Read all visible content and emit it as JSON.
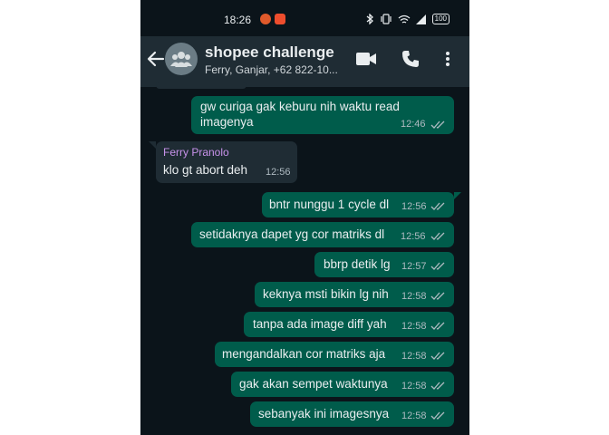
{
  "status_bar": {
    "time": "18:26",
    "battery": "100"
  },
  "header": {
    "title": "shopee challenge",
    "subtitle": "Ferry, Ganjar, +62 822-10..."
  },
  "colors": {
    "background": "#0b141a",
    "header": "#1f2c34",
    "outgoing_bubble": "#005c4b",
    "incoming_bubble": "#1f2c34",
    "sender_name": "#c792ea",
    "ticks": "#aebac1"
  },
  "messages": [
    {
      "direction": "out",
      "text_line1": "gw curiga gak keburu nih waktu read",
      "text_line2": "imagenya",
      "time": "12:46"
    },
    {
      "direction": "in",
      "sender": "Ferry Pranolo",
      "text": "klo gt abort deh",
      "time": "12:56"
    },
    {
      "direction": "out",
      "text": "bntr nunggu 1 cycle dl",
      "time": "12:56"
    },
    {
      "direction": "out",
      "text": "setidaknya dapet yg cor matriks dl",
      "time": "12:56"
    },
    {
      "direction": "out",
      "text": "bbrp detik lg",
      "time": "12:57"
    },
    {
      "direction": "out",
      "text": "keknya msti bikin lg nih",
      "time": "12:58"
    },
    {
      "direction": "out",
      "text": "tanpa ada image diff yah",
      "time": "12:58"
    },
    {
      "direction": "out",
      "text": "mengandalkan cor matriks aja",
      "time": "12:58"
    },
    {
      "direction": "out",
      "text": "gak akan sempet waktunya",
      "time": "12:58"
    },
    {
      "direction": "out",
      "text": "sebanyak ini imagesnya",
      "time": "12:58"
    }
  ],
  "icons": {
    "back": "arrow-left-icon",
    "avatar": "group-avatar-icon",
    "video": "video-call-icon",
    "call": "phone-call-icon",
    "menu": "more-vert-icon",
    "bluetooth": "bluetooth-icon",
    "vibrate": "vibrate-icon",
    "wifi": "wifi-icon",
    "signal": "signal-icon",
    "battery": "battery-icon",
    "read_receipt": "double-check-icon"
  }
}
